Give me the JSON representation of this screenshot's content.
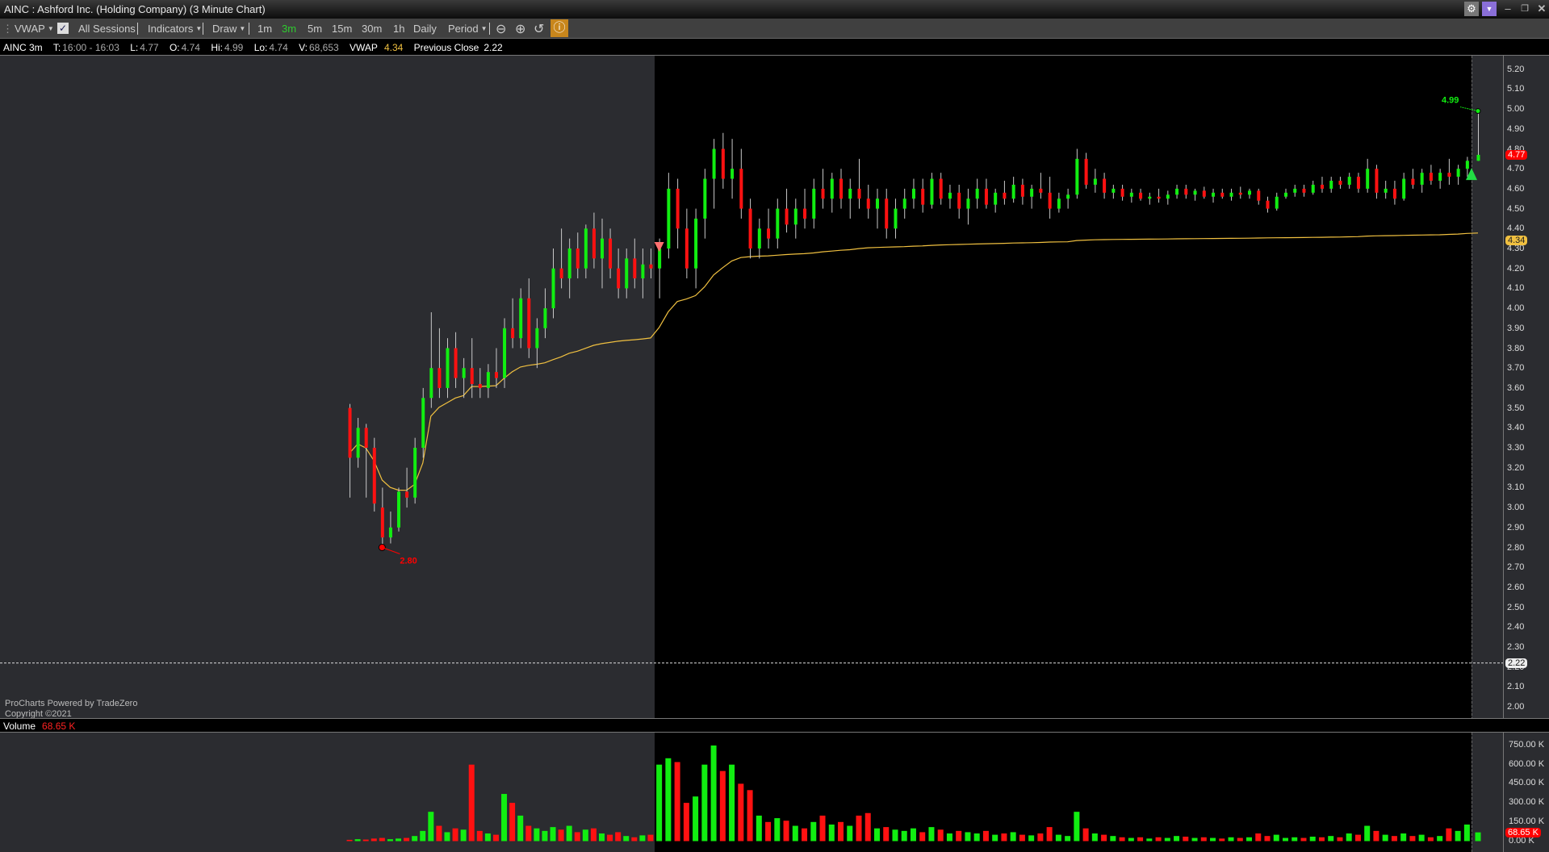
{
  "window": {
    "title": "AINC : Ashford Inc. (Holding Company) (3 Minute Chart)",
    "gear_icon": "gear-icon",
    "dropdown_icon": "caret-down-icon",
    "accent": "#8a6fd8"
  },
  "toolbar": {
    "vwap": "VWAP",
    "all_sessions": "All Sessions",
    "indicators": "Indicators",
    "draw": "Draw",
    "intervals": [
      "1m",
      "3m",
      "5m",
      "15m",
      "30m",
      "1h",
      "Daily"
    ],
    "active_interval": "3m",
    "period": "Period",
    "active_tool_color": "#c8861c"
  },
  "info": {
    "symbol": "AINC 3m",
    "t_label": "T:",
    "t": "16:00 - 16:03",
    "l_label": "L:",
    "l": "4.77",
    "o_label": "O:",
    "o": "4.74",
    "hi_label": "Hi:",
    "hi": "4.99",
    "lo_label": "Lo:",
    "lo": "4.74",
    "v_label": "V:",
    "v": "68,653",
    "vwap_label": "VWAP",
    "vwap": "4.34",
    "prev_label": "Previous Close",
    "prev": "2.22"
  },
  "credit": {
    "line1": "ProCharts Powered by TradeZero",
    "line2": "Copyright ©2021"
  },
  "volume": {
    "label": "Volume",
    "value": "68.65 K",
    "axis_labels": [
      "750.00 K",
      "600.00 K",
      "450.00 K",
      "300.00 K",
      "150.00 K",
      "0.00 K"
    ],
    "axis_values": [
      750,
      600,
      450,
      300,
      150,
      0
    ]
  },
  "chart_data": {
    "type": "candlestick",
    "title": "AINC 3 Minute Chart",
    "ylim": [
      2.0,
      5.2
    ],
    "y_ticks": [
      "5.20",
      "5.10",
      "5.00",
      "4.90",
      "4.80",
      "4.70",
      "4.60",
      "4.50",
      "4.40",
      "4.30",
      "4.20",
      "4.10",
      "4.00",
      "3.90",
      "3.80",
      "3.70",
      "3.60",
      "3.50",
      "3.40",
      "3.30",
      "3.20",
      "3.10",
      "3.00",
      "2.90",
      "2.80",
      "2.70",
      "2.60",
      "2.50",
      "2.40",
      "2.30",
      "2.20",
      "2.10",
      "2.00"
    ],
    "last_price": "4.77",
    "vwap_last": "4.34",
    "previous_close": "2.22",
    "high_label": "4.99",
    "low_label": "2.80",
    "colors": {
      "up": "#11ee11",
      "down": "#ff1111",
      "wick": "#c8c8c8",
      "vwap": "#f0c040"
    },
    "premarket_count": 38,
    "regular_count": 90,
    "candles_ohlcv_k": [
      [
        3.5,
        3.52,
        3.05,
        3.25,
        10
      ],
      [
        3.25,
        3.45,
        3.2,
        3.4,
        15
      ],
      [
        3.4,
        3.42,
        3.05,
        3.3,
        12
      ],
      [
        3.3,
        3.35,
        2.98,
        3.02,
        20
      ],
      [
        3.0,
        3.1,
        2.8,
        2.85,
        25
      ],
      [
        2.85,
        2.98,
        2.82,
        2.9,
        15
      ],
      [
        2.9,
        3.1,
        2.88,
        3.08,
        20
      ],
      [
        3.08,
        3.2,
        3.0,
        3.05,
        25
      ],
      [
        3.05,
        3.35,
        3.02,
        3.3,
        40
      ],
      [
        3.3,
        3.6,
        3.25,
        3.55,
        80
      ],
      [
        3.55,
        3.98,
        3.5,
        3.7,
        230
      ],
      [
        3.7,
        3.9,
        3.55,
        3.6,
        120
      ],
      [
        3.6,
        3.85,
        3.55,
        3.8,
        70
      ],
      [
        3.8,
        3.88,
        3.6,
        3.65,
        100
      ],
      [
        3.65,
        3.75,
        3.55,
        3.7,
        90
      ],
      [
        3.7,
        3.85,
        3.55,
        3.62,
        600
      ],
      [
        3.62,
        3.7,
        3.55,
        3.6,
        80
      ],
      [
        3.6,
        3.72,
        3.55,
        3.68,
        60
      ],
      [
        3.68,
        3.8,
        3.6,
        3.65,
        50
      ],
      [
        3.65,
        3.95,
        3.6,
        3.9,
        370
      ],
      [
        3.9,
        4.05,
        3.8,
        3.85,
        300
      ],
      [
        3.85,
        4.1,
        3.8,
        4.05,
        200
      ],
      [
        4.05,
        4.15,
        3.75,
        3.8,
        120
      ],
      [
        3.8,
        3.95,
        3.7,
        3.9,
        100
      ],
      [
        3.9,
        4.1,
        3.85,
        4.0,
        80
      ],
      [
        4.0,
        4.3,
        3.95,
        4.2,
        110
      ],
      [
        4.2,
        4.4,
        4.1,
        4.15,
        90
      ],
      [
        4.15,
        4.35,
        4.05,
        4.3,
        120
      ],
      [
        4.3,
        4.38,
        4.15,
        4.2,
        70
      ],
      [
        4.2,
        4.42,
        4.15,
        4.4,
        90
      ],
      [
        4.4,
        4.48,
        4.2,
        4.25,
        100
      ],
      [
        4.25,
        4.45,
        4.1,
        4.35,
        60
      ],
      [
        4.35,
        4.4,
        4.15,
        4.2,
        50
      ],
      [
        4.2,
        4.3,
        4.05,
        4.1,
        70
      ],
      [
        4.1,
        4.3,
        4.05,
        4.25,
        40
      ],
      [
        4.25,
        4.35,
        4.1,
        4.15,
        30
      ],
      [
        4.15,
        4.3,
        4.05,
        4.22,
        45
      ],
      [
        4.22,
        4.3,
        4.15,
        4.2,
        50
      ],
      [
        4.2,
        4.35,
        4.05,
        4.3,
        600
      ],
      [
        4.3,
        4.68,
        4.25,
        4.6,
        650
      ],
      [
        4.6,
        4.65,
        4.3,
        4.4,
        620
      ],
      [
        4.4,
        4.5,
        4.15,
        4.2,
        300
      ],
      [
        4.2,
        4.5,
        4.1,
        4.45,
        350
      ],
      [
        4.45,
        4.7,
        4.35,
        4.65,
        600
      ],
      [
        4.65,
        4.85,
        4.5,
        4.8,
        750
      ],
      [
        4.8,
        4.88,
        4.6,
        4.65,
        550
      ],
      [
        4.65,
        4.85,
        4.55,
        4.7,
        600
      ],
      [
        4.7,
        4.8,
        4.45,
        4.5,
        450
      ],
      [
        4.5,
        4.55,
        4.25,
        4.3,
        400
      ],
      [
        4.3,
        4.45,
        4.25,
        4.4,
        200
      ],
      [
        4.4,
        4.5,
        4.3,
        4.35,
        150
      ],
      [
        4.35,
        4.55,
        4.3,
        4.5,
        180
      ],
      [
        4.5,
        4.6,
        4.38,
        4.42,
        160
      ],
      [
        4.42,
        4.55,
        4.35,
        4.5,
        120
      ],
      [
        4.5,
        4.6,
        4.4,
        4.45,
        100
      ],
      [
        4.45,
        4.65,
        4.4,
        4.6,
        150
      ],
      [
        4.6,
        4.7,
        4.5,
        4.55,
        200
      ],
      [
        4.55,
        4.68,
        4.48,
        4.65,
        130
      ],
      [
        4.65,
        4.7,
        4.5,
        4.55,
        150
      ],
      [
        4.55,
        4.65,
        4.45,
        4.6,
        120
      ],
      [
        4.6,
        4.75,
        4.5,
        4.55,
        200
      ],
      [
        4.55,
        4.62,
        4.45,
        4.5,
        220
      ],
      [
        4.5,
        4.6,
        4.4,
        4.55,
        100
      ],
      [
        4.55,
        4.6,
        4.35,
        4.4,
        110
      ],
      [
        4.4,
        4.55,
        4.35,
        4.5,
        90
      ],
      [
        4.5,
        4.6,
        4.45,
        4.55,
        80
      ],
      [
        4.55,
        4.65,
        4.5,
        4.6,
        100
      ],
      [
        4.6,
        4.65,
        4.48,
        4.52,
        70
      ],
      [
        4.52,
        4.68,
        4.5,
        4.65,
        110
      ],
      [
        4.65,
        4.68,
        4.52,
        4.55,
        90
      ],
      [
        4.55,
        4.62,
        4.5,
        4.58,
        60
      ],
      [
        4.58,
        4.62,
        4.45,
        4.5,
        80
      ],
      [
        4.5,
        4.6,
        4.42,
        4.55,
        70
      ],
      [
        4.55,
        4.65,
        4.5,
        4.6,
        60
      ],
      [
        4.6,
        4.65,
        4.5,
        4.52,
        80
      ],
      [
        4.52,
        4.6,
        4.48,
        4.58,
        50
      ],
      [
        4.58,
        4.64,
        4.52,
        4.55,
        60
      ],
      [
        4.55,
        4.66,
        4.53,
        4.62,
        70
      ],
      [
        4.62,
        4.65,
        4.52,
        4.56,
        50
      ],
      [
        4.56,
        4.62,
        4.5,
        4.6,
        45
      ],
      [
        4.6,
        4.68,
        4.55,
        4.58,
        60
      ],
      [
        4.58,
        4.66,
        4.45,
        4.5,
        110
      ],
      [
        4.5,
        4.58,
        4.48,
        4.55,
        50
      ],
      [
        4.55,
        4.6,
        4.5,
        4.57,
        40
      ],
      [
        4.57,
        4.8,
        4.55,
        4.75,
        230
      ],
      [
        4.75,
        4.78,
        4.6,
        4.62,
        100
      ],
      [
        4.62,
        4.7,
        4.58,
        4.65,
        60
      ],
      [
        4.65,
        4.68,
        4.55,
        4.58,
        50
      ],
      [
        4.58,
        4.62,
        4.55,
        4.6,
        40
      ],
      [
        4.6,
        4.62,
        4.54,
        4.56,
        30
      ],
      [
        4.56,
        4.6,
        4.53,
        4.58,
        25
      ],
      [
        4.58,
        4.6,
        4.54,
        4.55,
        30
      ],
      [
        4.55,
        4.58,
        4.52,
        4.56,
        20
      ],
      [
        4.56,
        4.6,
        4.53,
        4.55,
        30
      ],
      [
        4.55,
        4.59,
        4.52,
        4.57,
        25
      ],
      [
        4.57,
        4.62,
        4.55,
        4.6,
        40
      ],
      [
        4.6,
        4.62,
        4.55,
        4.57,
        35
      ],
      [
        4.57,
        4.6,
        4.54,
        4.59,
        25
      ],
      [
        4.59,
        4.61,
        4.55,
        4.56,
        30
      ],
      [
        4.56,
        4.6,
        4.53,
        4.58,
        25
      ],
      [
        4.58,
        4.6,
        4.55,
        4.56,
        20
      ],
      [
        4.56,
        4.6,
        4.54,
        4.58,
        30
      ],
      [
        4.58,
        4.61,
        4.55,
        4.57,
        25
      ],
      [
        4.57,
        4.6,
        4.55,
        4.59,
        30
      ],
      [
        4.59,
        4.6,
        4.52,
        4.54,
        60
      ],
      [
        4.54,
        4.56,
        4.48,
        4.5,
        40
      ],
      [
        4.5,
        4.58,
        4.49,
        4.56,
        50
      ],
      [
        4.56,
        4.6,
        4.55,
        4.58,
        25
      ],
      [
        4.58,
        4.62,
        4.56,
        4.6,
        30
      ],
      [
        4.6,
        4.62,
        4.56,
        4.58,
        25
      ],
      [
        4.58,
        4.64,
        4.57,
        4.62,
        35
      ],
      [
        4.62,
        4.66,
        4.58,
        4.6,
        30
      ],
      [
        4.6,
        4.66,
        4.58,
        4.64,
        40
      ],
      [
        4.64,
        4.66,
        4.6,
        4.62,
        30
      ],
      [
        4.62,
        4.68,
        4.6,
        4.66,
        60
      ],
      [
        4.66,
        4.68,
        4.58,
        4.6,
        50
      ],
      [
        4.6,
        4.75,
        4.58,
        4.7,
        120
      ],
      [
        4.7,
        4.72,
        4.55,
        4.58,
        80
      ],
      [
        4.58,
        4.64,
        4.55,
        4.6,
        50
      ],
      [
        4.6,
        4.64,
        4.52,
        4.55,
        40
      ],
      [
        4.55,
        4.68,
        4.54,
        4.65,
        60
      ],
      [
        4.65,
        4.7,
        4.6,
        4.62,
        40
      ],
      [
        4.62,
        4.7,
        4.58,
        4.68,
        50
      ],
      [
        4.68,
        4.72,
        4.62,
        4.64,
        30
      ],
      [
        4.64,
        4.7,
        4.6,
        4.68,
        40
      ],
      [
        4.68,
        4.75,
        4.62,
        4.66,
        100
      ],
      [
        4.66,
        4.72,
        4.62,
        4.7,
        80
      ],
      [
        4.7,
        4.76,
        4.66,
        4.74,
        130
      ],
      [
        4.74,
        4.99,
        4.74,
        4.77,
        68.65
      ]
    ]
  }
}
